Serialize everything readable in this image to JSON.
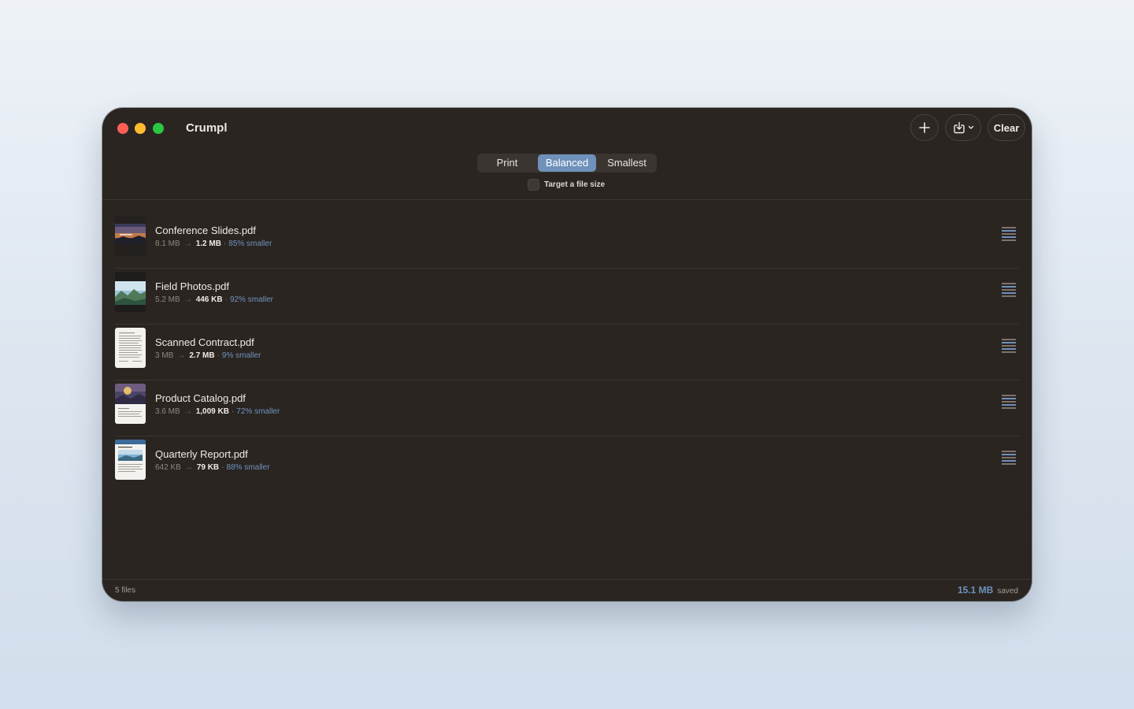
{
  "app": {
    "title": "Crumpl"
  },
  "toolbar": {
    "clear_label": "Clear"
  },
  "presets": {
    "options": [
      "Print",
      "Balanced",
      "Smallest"
    ],
    "selected": "Balanced"
  },
  "target": {
    "label": "Target a file size",
    "checked": false
  },
  "files": [
    {
      "name": "Conference Slides.pdf",
      "original": "8.1 MB",
      "compressed": "1.2 MB",
      "reduction": "85% smaller"
    },
    {
      "name": "Field Photos.pdf",
      "original": "5.2 MB",
      "compressed": "446 KB",
      "reduction": "92% smaller"
    },
    {
      "name": "Scanned Contract.pdf",
      "original": "3 MB",
      "compressed": "2.7 MB",
      "reduction": "9% smaller"
    },
    {
      "name": "Product Catalog.pdf",
      "original": "3.6 MB",
      "compressed": "1,009 KB",
      "reduction": "72% smaller"
    },
    {
      "name": "Quarterly Report.pdf",
      "original": "642 KB",
      "compressed": "79 KB",
      "reduction": "88% smaller"
    }
  ],
  "footer": {
    "count": "5 files",
    "saved_amount": "15.1 MB",
    "saved_label": "saved"
  },
  "colors": {
    "accent": "#6f91bb",
    "window_bg": "#2a2521"
  }
}
